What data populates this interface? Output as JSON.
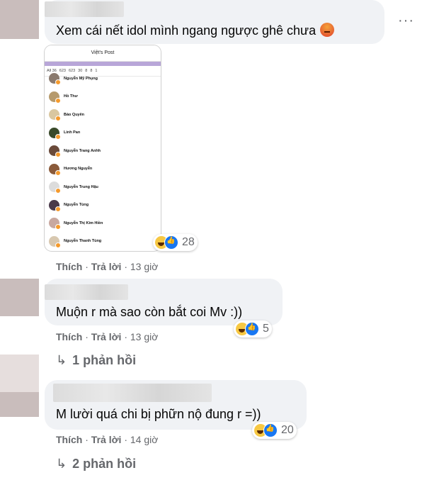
{
  "comments": [
    {
      "text": "Xem cái nết idol mình ngang ngược ghê chưa",
      "emoji": "angry-face-icon",
      "actions": {
        "like": "Thích",
        "reply": "Trả lời",
        "time": "13 giờ"
      },
      "reaction_count": "28",
      "more_label": "···"
    },
    {
      "text": "Muộn r mà sao còn bắt coi Mv :))",
      "actions": {
        "like": "Thích",
        "reply": "Trả lời",
        "time": "13 giờ"
      },
      "reaction_count": "5",
      "replies_label": "1 phản hồi"
    },
    {
      "text": "M lười quá chi bị phữn nộ đung r =))",
      "actions": {
        "like": "Thích",
        "reply": "Trả lời",
        "time": "14 giờ"
      },
      "reaction_count": "20",
      "replies_label": "2 phản hồi"
    }
  ],
  "shared_image": {
    "title": "Việt's Post",
    "counts": [
      "All 36",
      "623",
      "623",
      "30",
      "8",
      "8",
      "1"
    ],
    "people": [
      "Nguyễn Mỹ Phụng",
      "Hồ Thư",
      "Bảo Quyên",
      "Linh Pan",
      "Nguyễn Trang Anhh",
      "Hương Nguyễn",
      "Nguyễn Trung Hậu",
      "Nguyễn Tùng",
      "Nguyễn Thị Kim Hiền",
      "Nguyễn Thanh Tùng"
    ]
  },
  "separator": " · "
}
